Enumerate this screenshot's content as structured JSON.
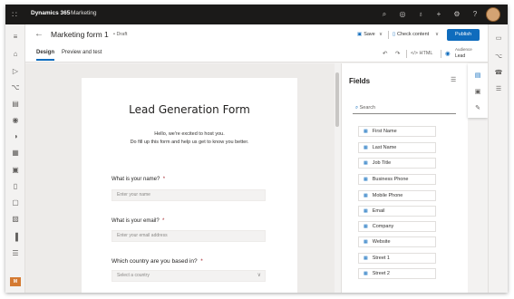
{
  "topbar": {
    "app_name": "Dynamics 365",
    "app_area": "Marketing",
    "icons": [
      "search-icon",
      "target-icon",
      "lightbulb-icon",
      "plus-icon",
      "gear-icon",
      "help-icon"
    ]
  },
  "left_nav": {
    "icons": [
      "menu-icon",
      "home-icon",
      "play-icon",
      "flow-icon",
      "library-icon",
      "pin-icon",
      "segment-icon",
      "grid-icon",
      "calendar-icon",
      "document-icon",
      "page-icon",
      "form-icon",
      "chart-icon",
      "list-icon"
    ],
    "area_badge": "M"
  },
  "command_bar": {
    "title": "Marketing form 1",
    "status": "• Draft",
    "save_label": "Save",
    "check_content_label": "Check content",
    "publish_label": "Publish"
  },
  "tabs": {
    "design": "Design",
    "preview": "Preview and test"
  },
  "toolbar": {
    "html_label": "HTML",
    "audience_label": "Audience",
    "audience_value": "Lead"
  },
  "form": {
    "title": "Lead Generation Form",
    "intro_line1": "Hello, we're excited to host you.",
    "intro_line2": "Do fill up this form and help us get to know you better.",
    "questions": [
      {
        "label": "What is your name?",
        "required": "*",
        "placeholder": "Enter your name"
      },
      {
        "label": "What is your email?",
        "required": "*",
        "placeholder": "Enter your email address"
      },
      {
        "label": "Which country are you based in?",
        "required": "*",
        "placeholder": "Select a country"
      }
    ]
  },
  "fields_panel": {
    "title": "Fields",
    "search_placeholder": "Search",
    "items": [
      "First Name",
      "Last Name",
      "Job Title",
      "Business Phone",
      "Mobile Phone",
      "Email",
      "Company",
      "Website",
      "Street 1",
      "Street 2"
    ]
  },
  "colors": {
    "accent": "#0f6cbd",
    "topbar": "#1b1a19",
    "required": "#a4262c"
  }
}
